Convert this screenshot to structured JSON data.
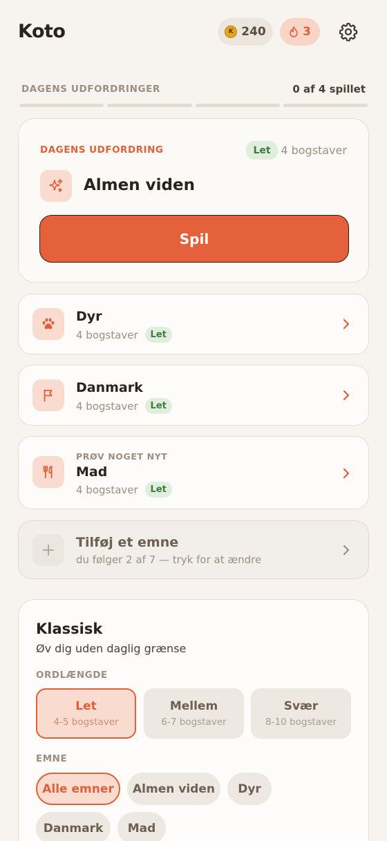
{
  "app": {
    "title": "Koto"
  },
  "header": {
    "coins": "240",
    "coin_symbol": "K",
    "streak": "3",
    "settings_icon": "gear-icon"
  },
  "progress": {
    "label": "DAGENS UDFORDRINGER",
    "count": "0 af 4 spillet",
    "total": 4,
    "completed": 0
  },
  "daily": {
    "label": "DAGENS UDFORDRING",
    "difficulty": "Let",
    "letters": "4 bogstaver",
    "title": "Almen viden",
    "icon": "sparkles-icon",
    "play_label": "Spil"
  },
  "topics": [
    {
      "name": "Dyr",
      "letters": "4 bogstaver",
      "difficulty": "Let",
      "icon": "paw-icon"
    },
    {
      "name": "Danmark",
      "letters": "4 bogstaver",
      "difficulty": "Let",
      "icon": "flag-icon"
    },
    {
      "kicker": "PRØV NOGET NYT",
      "name": "Mad",
      "letters": "4 bogstaver",
      "difficulty": "Let",
      "icon": "utensils-icon"
    }
  ],
  "add_topic": {
    "title": "Tilføj et emne",
    "subtitle": "du følger 2 af 7 — tryk for at ændre",
    "icon": "plus-icon"
  },
  "classic": {
    "title": "Klassisk",
    "subtitle": "Øv dig uden daglig grænse",
    "length_label": "ORDLÆNGDE",
    "levels": [
      {
        "name": "Let",
        "range": "4-5 bogstaver",
        "selected": true
      },
      {
        "name": "Mellem",
        "range": "6-7 bogstaver",
        "selected": false
      },
      {
        "name": "Svær",
        "range": "8-10 bogstaver",
        "selected": false
      }
    ],
    "topic_label": "EMNE",
    "chips": [
      {
        "label": "Alle emner",
        "selected": true
      },
      {
        "label": "Almen viden",
        "selected": false
      },
      {
        "label": "Dyr",
        "selected": false
      },
      {
        "label": "Danmark",
        "selected": false
      },
      {
        "label": "Mad",
        "selected": false
      }
    ]
  },
  "colors": {
    "accent": "#e4613b",
    "background": "#f7f4ef",
    "success": "#3f7a3c"
  }
}
